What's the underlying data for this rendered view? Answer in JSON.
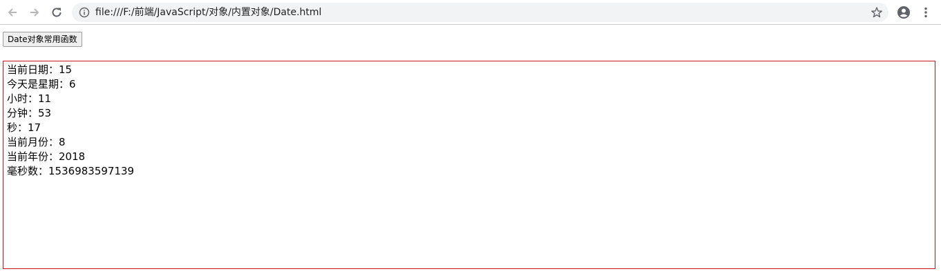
{
  "browser": {
    "url": "file:///F:/前端/JavaScript/对象/内置对象/Date.html",
    "icons": {
      "back": "arrow-left-icon",
      "forward": "arrow-right-icon",
      "reload": "reload-icon",
      "info": "info-icon",
      "bookmark": "star-icon",
      "profile": "account-circle-icon",
      "menu": "more-vert-icon"
    }
  },
  "page": {
    "button_label": "Date对象常用函数",
    "output_border_color": "#c8141e",
    "output": [
      {
        "label": "当前日期：",
        "value": "15"
      },
      {
        "label": "今天是星期：",
        "value": "6"
      },
      {
        "label": "小时：",
        "value": "11"
      },
      {
        "label": "分钟：",
        "value": "53"
      },
      {
        "label": "秒：",
        "value": "17"
      },
      {
        "label": "当前月份：",
        "value": "8"
      },
      {
        "label": "当前年份：",
        "value": "2018"
      },
      {
        "label": "毫秒数：",
        "value": "1536983597139"
      }
    ]
  }
}
